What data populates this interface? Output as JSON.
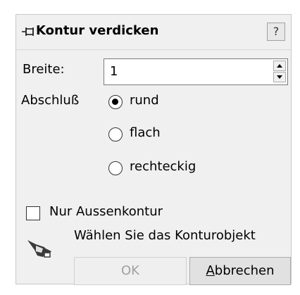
{
  "dialog": {
    "title": "Kontur verdicken",
    "help_label": "?"
  },
  "width": {
    "label": "Breite:",
    "value": "1"
  },
  "cap": {
    "label": "Abschluß",
    "options": [
      {
        "label": "rund",
        "checked": true
      },
      {
        "label": "flach",
        "checked": false
      },
      {
        "label": "rechteckig",
        "checked": false
      }
    ]
  },
  "outer_only": {
    "label": "Nur Aussenkontur",
    "checked": false
  },
  "hint": {
    "text": "Wählen Sie das Konturobjekt",
    "icon": "pointing-hand-icon"
  },
  "buttons": {
    "ok_label": "OK",
    "cancel_mnemonic": "A",
    "cancel_rest": "bbrechen"
  }
}
